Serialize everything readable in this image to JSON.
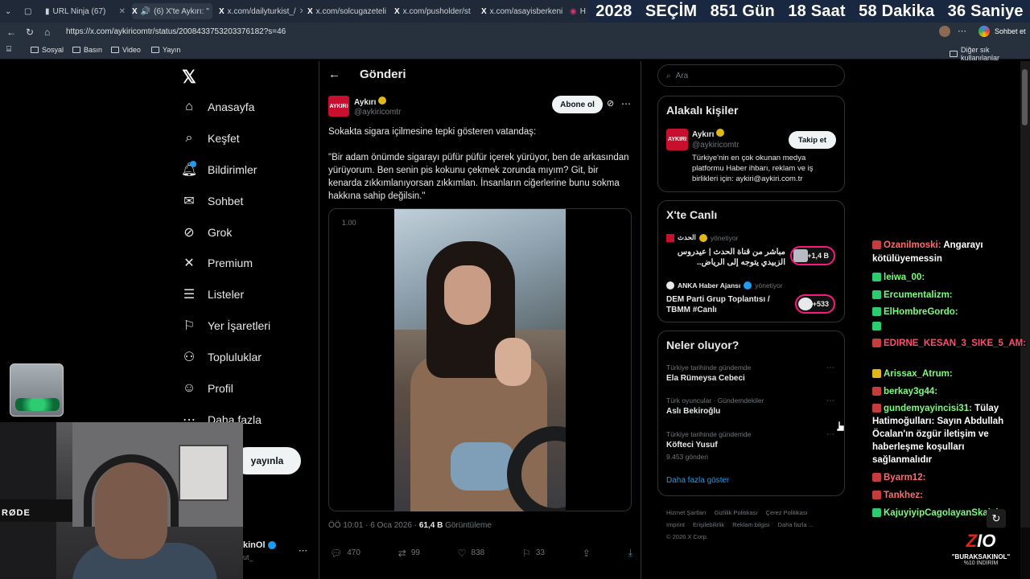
{
  "browser": {
    "tabs": [
      {
        "label": "URL Ninja (67)"
      },
      {
        "label": "(6) X'te Aykırı: \""
      },
      {
        "label": "x.com/dailyturkist_/"
      },
      {
        "label": "x.com/solcugazeteli"
      },
      {
        "label": "x.com/pusholder/st"
      },
      {
        "label": "x.com/asayisberkeni"
      },
      {
        "label": "H"
      }
    ],
    "url": "https://x.com/aykiricomtr/status/2008433753203376182?s=46",
    "profile_action": "Sohbet et",
    "bookmarks": [
      "Sosyal",
      "Basın",
      "Video",
      "Yayın"
    ],
    "bookmarks_other": "Diğer sık kullanılanlar"
  },
  "countdown": {
    "year": "2028",
    "label": "SEÇİM",
    "days": "851 Gün",
    "hours": "18 Saat",
    "minutes": "58 Dakika",
    "seconds": "36 Saniye"
  },
  "nav": {
    "items": [
      {
        "label": "Anasayfa"
      },
      {
        "label": "Keşfet"
      },
      {
        "label": "Bildirimler"
      },
      {
        "label": "Sohbet"
      },
      {
        "label": "Grok"
      },
      {
        "label": "Premium"
      },
      {
        "label": "Listeler"
      },
      {
        "label": "Yer İşaretleri"
      },
      {
        "label": "Topluluklar"
      },
      {
        "label": "Profil"
      },
      {
        "label": "Daha fazla"
      }
    ],
    "post_button": "yayınla",
    "account_name": "kinOl",
    "account_handle": "ut_"
  },
  "post": {
    "header": "Gönderi",
    "author_name": "Aykırı",
    "author_handle": "@aykiricomtr",
    "avatar_text": "AYKIRI",
    "follow_label": "Abone ol",
    "text1": "Sokakta sigara içilmesine tepki gösteren vatandaş:",
    "text2": "\"Bir adam önümde sigarayı püfür püfür içerek yürüyor, ben de arkasından yürüyorum. Ben senin pis kokunu çekmek zorunda mıyım? Git, bir kenarda zıkkımlanıyorsan zıkkımlan. İnsanların ciğerlerine bunu sokma hakkına sahip değilsin.\"",
    "video_speed": "1.00",
    "time": "ÖÖ 10:01 · 6 Oca 2026 · ",
    "views_count": "61,4 B",
    "views_label": " Görüntüleme",
    "replies": "470",
    "reposts": "99",
    "likes": "838",
    "bookmarks": "33"
  },
  "sidebar": {
    "search_placeholder": "Ara",
    "people_title": "Alakalı kişiler",
    "person": {
      "name": "Aykırı",
      "handle": "@aykiricomtr",
      "follow_label": "Takip et",
      "bio": "Türkiye'nin en çok okunan medya platformu Haber ihbarı, reklam ve iş birlikleri için: aykiri@aykiri.com.tr"
    },
    "live_title": "X'te Canlı",
    "live": [
      {
        "host": "الحدث",
        "status": "yönetiyor",
        "title": "مباشر من قناة الحدث | عيدروس الزبيدي يتوجه إلى الرياض..",
        "count": "+1,4 B"
      },
      {
        "host": "ANKA Haber Ajansı",
        "status": "yönetiyor",
        "title": "DEM Parti Grup Toplantısı / TBMM #Canlı",
        "count": "+533"
      }
    ],
    "trends_title": "Neler oluyor?",
    "trends": [
      {
        "meta": "Türkiye tarihinde gündemde",
        "name": "Ela Rümeysa Cebeci",
        "posts": ""
      },
      {
        "meta": "Türk oyuncular · Gündemdekiler",
        "name": "Aslı Bekiroğlu",
        "posts": ""
      },
      {
        "meta": "Türkiye tarihinde gündemde",
        "name": "Köfteci Yusuf",
        "posts": "9.453 gönderi"
      }
    ],
    "show_more": "Daha fazla göster",
    "footer": [
      "Hizmet Şartları",
      "Gizlilik Politikası",
      "Çerez Politikası",
      "Imprint",
      "Erişilebilirlik",
      "Reklam bilgisi",
      "Daha fazla ...",
      "© 2026 X Corp."
    ]
  },
  "chat": [
    {
      "user": "Ozanilmoski:",
      "msg": " Angarayı",
      "color": "#ff6b6b"
    },
    {
      "user": "",
      "msg": "kötülüyemessin",
      "color": "#ffffff"
    },
    {
      "user": "leiwa_00:",
      "msg": "",
      "color": "#7cfc7c"
    },
    {
      "user": "Ercumentalizm:",
      "msg": "",
      "color": "#7cfc7c"
    },
    {
      "user": "ElHombreGordo:",
      "msg": "",
      "color": "#7cfc7c"
    },
    {
      "user": "",
      "msg": "",
      "color": "#ffffff"
    },
    {
      "user": "EDIRNE_KESAN_3_SIKE_5_AM:",
      "msg": "",
      "color": "#ff4d6d"
    },
    {
      "user": "Arissax_Atrum:",
      "msg": "",
      "color": "#7cfc7c"
    },
    {
      "user": "berkay3g44:",
      "msg": "",
      "color": "#7cfc7c"
    },
    {
      "user": "gundemyayincisi31:",
      "msg": " Tülay",
      "color": "#7cfc7c"
    },
    {
      "user": "",
      "msg": "Hatimoğulları: Sayın Abdullah",
      "color": "#ffffff"
    },
    {
      "user": "",
      "msg": "Öcalan'ın özgür iletişim ve",
      "color": "#ffffff"
    },
    {
      "user": "",
      "msg": "haberleşme koşulları",
      "color": "#ffffff"
    },
    {
      "user": "",
      "msg": "sağlanmalıdır",
      "color": "#ffffff"
    },
    {
      "user": "Byarm12:",
      "msg": "",
      "color": "#ff6b6b"
    },
    {
      "user": "Tankhez:",
      "msg": "",
      "color": "#ff6b6b"
    },
    {
      "user": "KajuyiyipCagolayanSkalek",
      "msg": "",
      "color": "#7cfc7c"
    }
  ],
  "overlay": {
    "rode": "RØDE",
    "promo_brand_a": "Z",
    "promo_brand_b": "IO",
    "promo_code": "\"BURAKSAKINOL\"",
    "promo_discount": "%10 İNDİRİM"
  },
  "colors": {
    "accent": "#1d9bf0",
    "live": "#f91880",
    "brand_red": "#c8102e"
  }
}
